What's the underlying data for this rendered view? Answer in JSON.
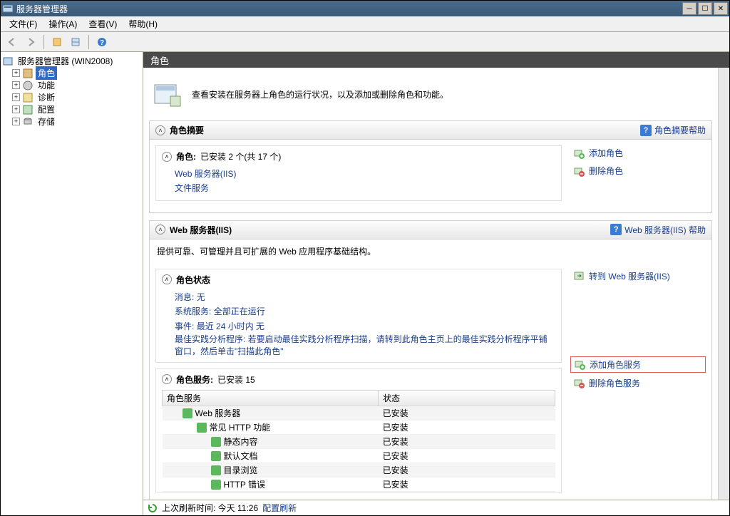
{
  "title": "服务器管理器",
  "menus": {
    "file": "文件(F)",
    "action": "操作(A)",
    "view": "查看(V)",
    "help": "帮助(H)"
  },
  "tree": {
    "root": "服务器管理器 (WIN2008)",
    "roles": "角色",
    "features": "功能",
    "diagnostics": "诊断",
    "configuration": "配置",
    "storage": "存储"
  },
  "header": "角色",
  "intro": "查看安装在服务器上角色的运行状况，以及添加或删除角色和功能。",
  "summary": {
    "title": "角色摘要",
    "help": "角色摘要帮助",
    "rolesHeading": "角色:",
    "rolesCount": "已安装 2 个(共 17 个)",
    "installed": [
      "Web 服务器(IIS)",
      "文件服务"
    ],
    "addRole": "添加角色",
    "removeRole": "删除角色"
  },
  "iis": {
    "title": "Web 服务器(IIS)",
    "help": "Web 服务器(IIS) 帮助",
    "desc": "提供可靠、可管理并且可扩展的 Web 应用程序基础结构。",
    "statusTitle": "角色状态",
    "goto": "转到 Web 服务器(IIS)",
    "msgLabel": "消息:",
    "msgVal": "无",
    "svcLabel": "系统服务:",
    "svcVal": "全部正在运行",
    "evtLabel": "事件:",
    "evtVal": "最近 24 小时内 无",
    "bpa": "最佳实践分析程序: 若要启动最佳实践分析程序扫描，请转到此角色主页上的最佳实践分析程序平铺窗口，然后单击\"扫描此角色\"",
    "servicesTitle": "角色服务:",
    "servicesCount": "已安装 15",
    "addService": "添加角色服务",
    "removeService": "删除角色服务",
    "cols": {
      "name": "角色服务",
      "status": "状态"
    },
    "rows": [
      {
        "name": "Web 服务器",
        "status": "已安装",
        "indent": 1
      },
      {
        "name": "常见 HTTP 功能",
        "status": "已安装",
        "indent": 2
      },
      {
        "name": "静态内容",
        "status": "已安装",
        "indent": 3
      },
      {
        "name": "默认文档",
        "status": "已安装",
        "indent": 3
      },
      {
        "name": "目录浏览",
        "status": "已安装",
        "indent": 3
      },
      {
        "name": "HTTP 错误",
        "status": "已安装",
        "indent": 3
      }
    ]
  },
  "statusbar": {
    "lastRefresh": "上次刷新时间: 今天 11:26",
    "configRefresh": "配置刷新"
  }
}
